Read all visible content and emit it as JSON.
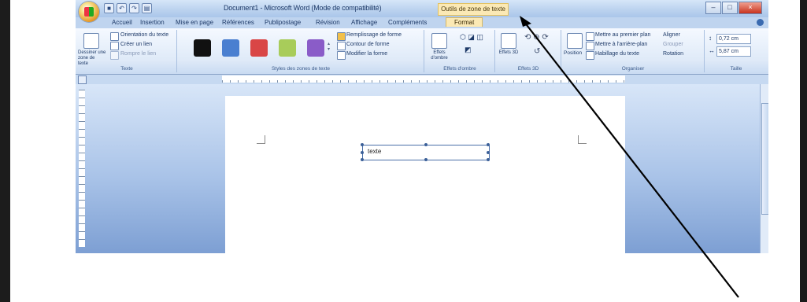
{
  "window": {
    "doc_title": "Document1 - Microsoft Word (Mode de compatibilité)",
    "contextual_title": "Outils de zone de texte",
    "controls": [
      "–",
      "□",
      "×"
    ]
  },
  "quick_access": [
    "save-icon",
    "undo-icon",
    "redo-icon",
    "print-icon"
  ],
  "tabs": [
    "Accueil",
    "Insertion",
    "Mise en page",
    "Références",
    "Publipostage",
    "Révision",
    "Affichage",
    "Compléments",
    "Format"
  ],
  "active_tab": "Format",
  "ribbon": {
    "texte": {
      "label": "Texte",
      "draw_text_box": "Dessiner une zone de texte",
      "text_direction": "Orientation du texte",
      "create_link": "Créer un lien",
      "break_link": "Rompre le lien"
    },
    "styles": {
      "label": "Styles des zones de texte",
      "swatch_colors": [
        "#111111",
        "#4a7fd0",
        "#d94646",
        "#a8cc5a",
        "#8a5cc8"
      ],
      "fill": "Remplissage de forme",
      "outline": "Contour de forme",
      "change_shape": "Modifier la forme"
    },
    "shadow": {
      "label": "Effets d'ombre",
      "button": "Effets d'ombre"
    },
    "effects3d": {
      "label": "Effets 3D",
      "button": "Effets 3D"
    },
    "arrange": {
      "label": "Organiser",
      "position": "Position",
      "bring_front": "Mettre au premier plan",
      "send_back": "Mettre à l'arrière-plan",
      "wrap": "Habillage du texte",
      "align": "Aligner",
      "group": "Grouper",
      "rotate": "Rotation"
    },
    "size": {
      "label": "Taille",
      "height": "0,72 cm",
      "width": "5,87 cm"
    }
  },
  "document": {
    "textbox_text": "texte"
  }
}
